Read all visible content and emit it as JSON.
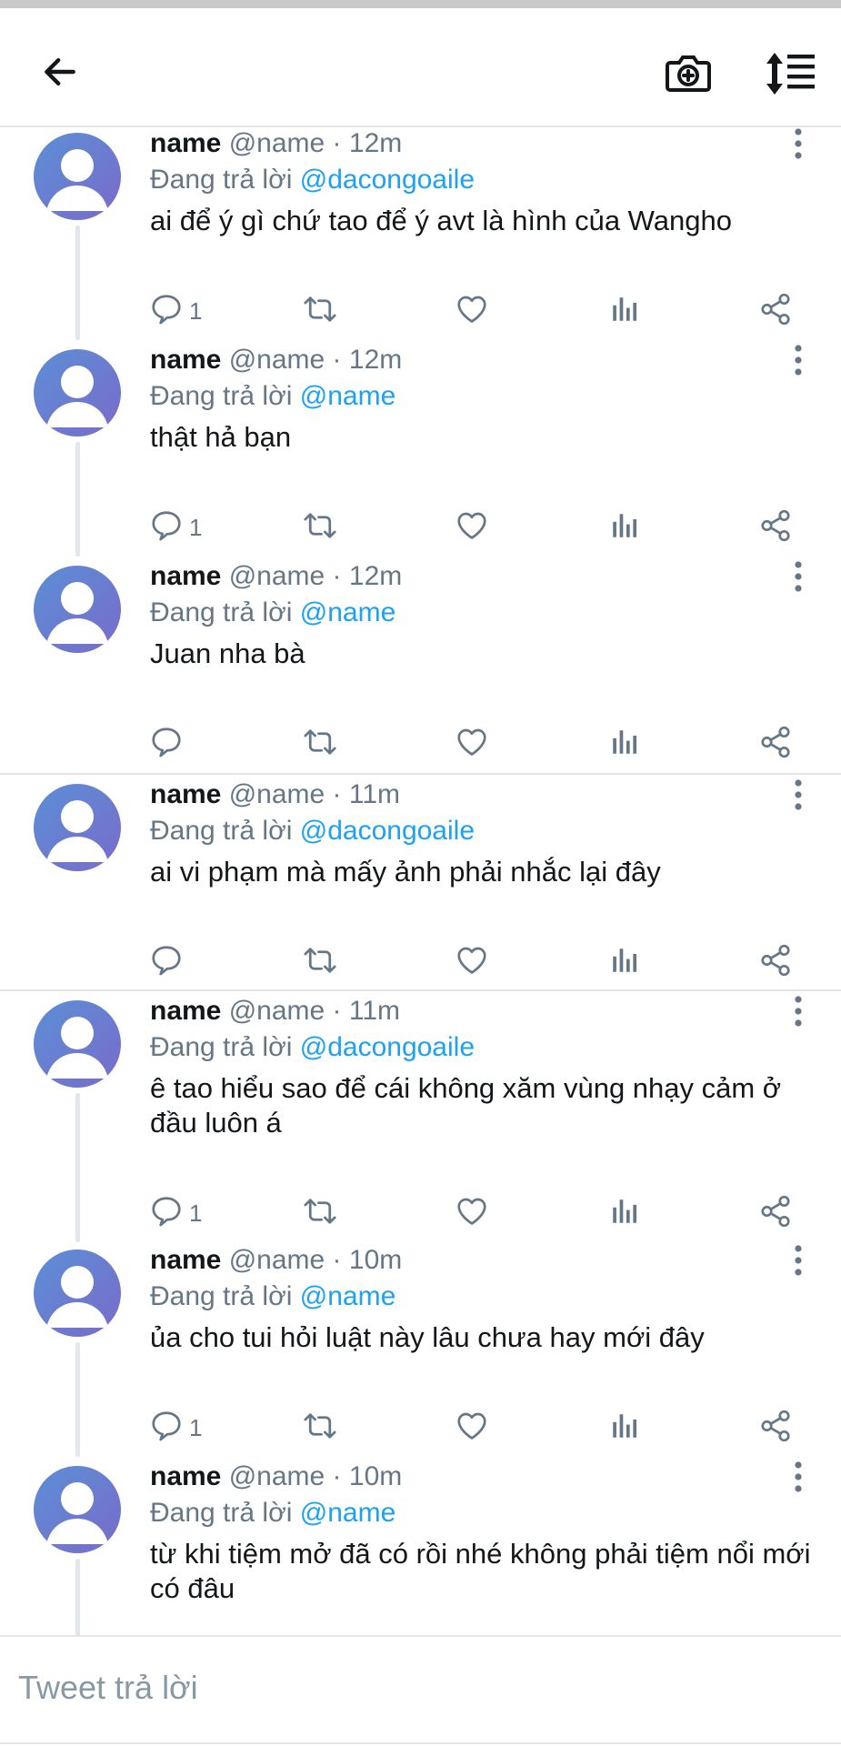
{
  "header": {
    "back_icon": "arrow-left-icon",
    "camera_icon": "camera-plus-icon",
    "sort_icon": "sort-list-icon"
  },
  "colors": {
    "mention": "#1da1f2",
    "secondary_text": "#657786",
    "avatar_gradient": [
      "#5b8fd6",
      "#7a6bc9"
    ]
  },
  "replies": [
    {
      "name": "name",
      "handle": "@name",
      "time": "12m",
      "replying_label": "Đang trả lời",
      "replying_to": "@dacongoaile",
      "text": "ai để ý gì chứ tao để ý avt là hình của Wangho",
      "reply_count": "1"
    },
    {
      "name": "name",
      "handle": "@name",
      "time": "12m",
      "replying_label": "Đang trả lời",
      "replying_to": "@name",
      "text": "thật hả bạn",
      "reply_count": "1"
    },
    {
      "name": "name",
      "handle": "@name",
      "time": "12m",
      "replying_label": "Đang trả lời",
      "replying_to": "@name",
      "text": "Juan nha bà",
      "reply_count": ""
    },
    {
      "name": "name",
      "handle": "@name",
      "time": "11m",
      "replying_label": "Đang trả lời",
      "replying_to": "@dacongoaile",
      "text": "ai vi phạm mà mấy ảnh phải nhắc lại đây",
      "reply_count": ""
    },
    {
      "name": "name",
      "handle": "@name",
      "time": "11m",
      "replying_label": "Đang trả lời",
      "replying_to": "@dacongoaile",
      "text": "ê tao hiểu sao để cái không xăm vùng nhạy cảm ở đầu luôn á",
      "reply_count": "1"
    },
    {
      "name": "name",
      "handle": "@name",
      "time": "10m",
      "replying_label": "Đang trả lời",
      "replying_to": "@name",
      "text": "ủa cho tui hỏi luật này lâu chưa hay mới đây",
      "reply_count": "1"
    },
    {
      "name": "name",
      "handle": "@name",
      "time": "10m",
      "replying_label": "Đang trả lời",
      "replying_to": "@name",
      "text": "từ khi tiệm mở đã có rồi nhé không phải tiệm nổi mới có đâu",
      "reply_count": ""
    }
  ],
  "composer": {
    "placeholder": "Tweet trả lời"
  }
}
